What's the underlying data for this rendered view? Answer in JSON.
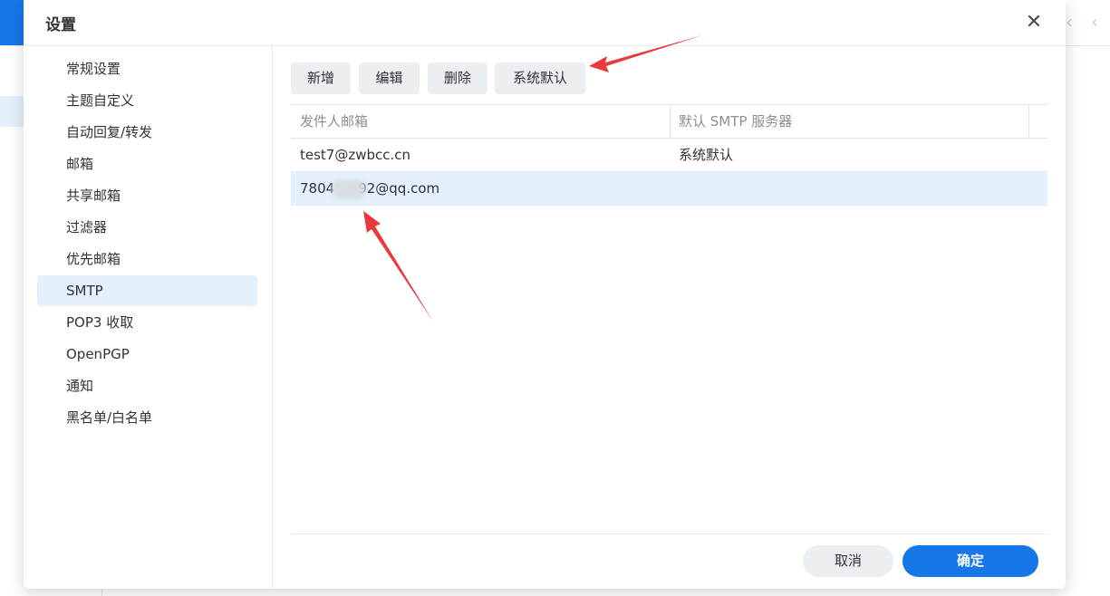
{
  "dialog": {
    "title": "设置",
    "close_icon": "close-icon"
  },
  "sidebar": {
    "items": [
      {
        "label": "常规设置"
      },
      {
        "label": "主题自定义"
      },
      {
        "label": "自动回复/转发"
      },
      {
        "label": "邮箱"
      },
      {
        "label": "共享邮箱"
      },
      {
        "label": "过滤器"
      },
      {
        "label": "优先邮箱"
      },
      {
        "label": "SMTP",
        "active": true
      },
      {
        "label": "POP3 收取"
      },
      {
        "label": "OpenPGP"
      },
      {
        "label": "通知"
      },
      {
        "label": "黑名单/白名单"
      }
    ]
  },
  "toolbar": {
    "add_label": "新增",
    "edit_label": "编辑",
    "delete_label": "删除",
    "default_label": "系统默认"
  },
  "table": {
    "columns": [
      "发件人邮箱",
      "默认 SMTP 服务器"
    ],
    "rows": [
      {
        "sender": "test7@zwbcc.cn",
        "smtp": "系统默认"
      },
      {
        "sender_prefix": "7804",
        "sender_suffix": "92@qq.com",
        "smtp": "",
        "selected": true
      }
    ]
  },
  "footer": {
    "cancel_label": "取消",
    "ok_label": "确定"
  },
  "colors": {
    "accent": "#1677e8",
    "selected_row": "#e4f0fb",
    "annotation_arrow": "#e8393c"
  }
}
